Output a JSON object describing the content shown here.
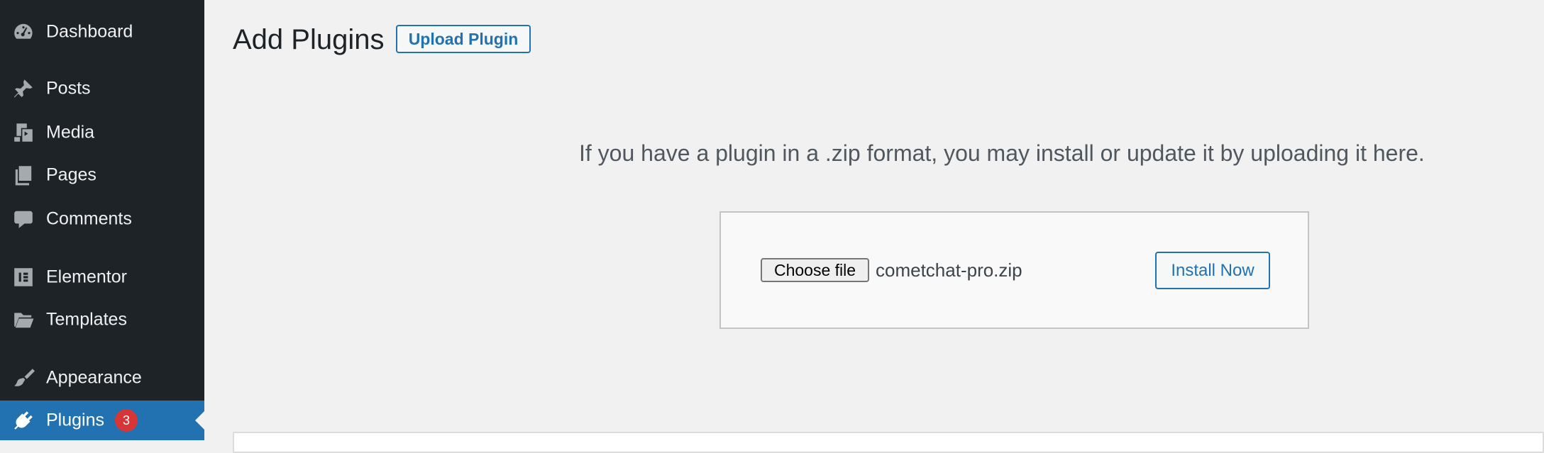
{
  "sidebar": {
    "items": [
      {
        "label": "Dashboard",
        "icon": "dashboard-icon"
      },
      {
        "label": "Posts",
        "icon": "pushpin-icon"
      },
      {
        "label": "Media",
        "icon": "media-icon"
      },
      {
        "label": "Pages",
        "icon": "pages-icon"
      },
      {
        "label": "Comments",
        "icon": "comment-icon"
      },
      {
        "label": "Elementor",
        "icon": "elementor-icon"
      },
      {
        "label": "Templates",
        "icon": "folder-icon"
      },
      {
        "label": "Appearance",
        "icon": "paintbrush-icon"
      },
      {
        "label": "Plugins",
        "icon": "plugin-icon",
        "badge": "3",
        "active": true
      }
    ]
  },
  "page": {
    "title": "Add Plugins",
    "upload_button": "Upload Plugin",
    "help_text": "If you have a plugin in a .zip format, you may install or update it by uploading it here.",
    "choose_file_label": "Choose file",
    "selected_file": "cometchat-pro.zip",
    "install_button": "Install Now"
  },
  "colors": {
    "sidebar_bg": "#1d2327",
    "active_bg": "#2271b1",
    "accent": "#2271b1",
    "badge": "#d63638",
    "page_bg": "#f1f1f1"
  }
}
